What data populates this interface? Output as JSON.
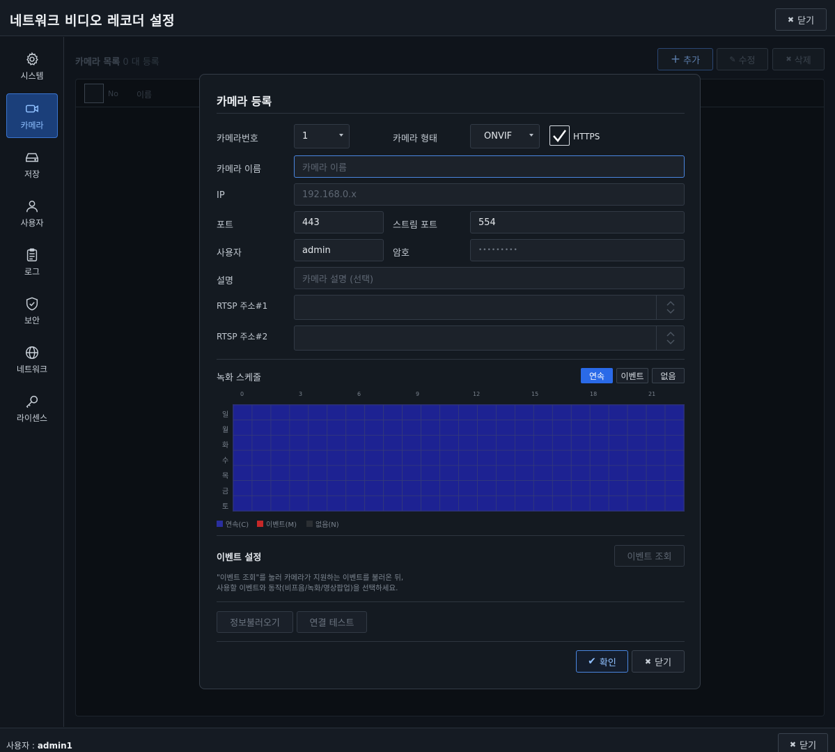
{
  "app": {
    "title": "네트워크 비디오 레코더 설정",
    "close_label": "닫기"
  },
  "sidebar": {
    "items": [
      {
        "label": "시스템",
        "icon": "gear-icon"
      },
      {
        "label": "카메라",
        "icon": "camera-icon"
      },
      {
        "label": "저장",
        "icon": "storage-icon"
      },
      {
        "label": "사용자",
        "icon": "user-icon"
      },
      {
        "label": "로그",
        "icon": "clipboard-icon"
      },
      {
        "label": "보안",
        "icon": "shield-icon"
      },
      {
        "label": "네트워크",
        "icon": "globe-icon"
      },
      {
        "label": "라이센스",
        "icon": "key-icon"
      }
    ],
    "active": "카메라"
  },
  "background": {
    "list_title": "카메라 목록",
    "list_count": "0 대 등록",
    "add_label": "추가",
    "edit_label": "수정",
    "delete_label": "삭제",
    "columns": [
      "No",
      "이름"
    ]
  },
  "modal": {
    "title": "카메라 등록",
    "camera_number": {
      "label": "카메라번호",
      "value": "1"
    },
    "camera_type": {
      "label": "카메라 형태",
      "value": "ONVIF"
    },
    "https": {
      "label": "HTTPS",
      "checked": true
    },
    "camera_name": {
      "label": "카메라 이름",
      "placeholder": "카메라 이름"
    },
    "ip": {
      "label": "IP",
      "placeholder": "192.168.0.x"
    },
    "port": {
      "label": "포트",
      "value": "443"
    },
    "stream_port": {
      "label": "스트림 포트",
      "value": "554"
    },
    "user": {
      "label": "사용자",
      "value": "admin"
    },
    "password": {
      "label": "암호",
      "value": "•••••••••"
    },
    "description": {
      "label": "설명",
      "placeholder": "카메라 설명 (선택)"
    },
    "rtsp1": {
      "label": "RTSP 주소#1",
      "value": ""
    },
    "rtsp2": {
      "label": "RTSP 주소#2",
      "value": ""
    },
    "schedule": {
      "title": "녹화 스케줄",
      "modes": [
        "연속",
        "이벤트",
        "없음"
      ],
      "active_mode": "연속",
      "hour_labels": [
        "0",
        "3",
        "6",
        "9",
        "12",
        "15",
        "18",
        "21"
      ],
      "days": [
        "일",
        "월",
        "화",
        "수",
        "목",
        "금",
        "토"
      ],
      "hours_per_day": 24,
      "fill_color": "#1d2292",
      "legend": [
        {
          "label": "연속(C)",
          "color": "#2a2f9e"
        },
        {
          "label": "이벤트(M)",
          "color": "#c62828"
        },
        {
          "label": "없음(N)",
          "color": "#2b2f33"
        }
      ]
    },
    "event": {
      "title": "이벤트 설정",
      "query_label": "이벤트 조회",
      "desc_line1": "\"이벤트 조회\"를 눌러 카메라가 지원하는 이벤트를 불러온 뒤,",
      "desc_line2": "사용할 이벤트와 동작(비프음/녹화/영상팝업)을 선택하세요."
    },
    "load_info_label": "정보불러오기",
    "test_label": "연결 테스트",
    "ok_label": "확인",
    "cancel_label": "닫기"
  },
  "status": {
    "user_label": "사용자 :",
    "user_value": "admin1",
    "close_label": "닫기"
  },
  "colors": {
    "accent": "#2a6ae8",
    "active_nav": "#1b3f7a",
    "schedule_fill": "#1d2292"
  }
}
